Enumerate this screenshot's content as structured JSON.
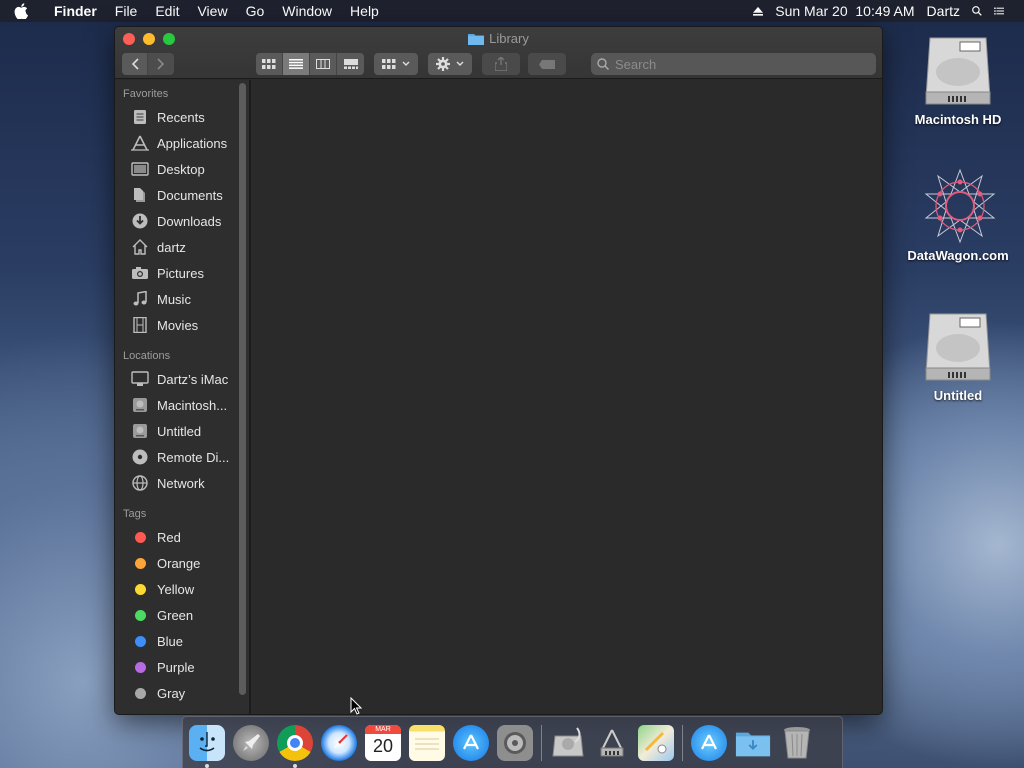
{
  "menubar": {
    "app_name": "Finder",
    "menus": [
      "File",
      "Edit",
      "View",
      "Go",
      "Window",
      "Help"
    ],
    "clock": "Sun Mar 20  10:49 AM",
    "user": "Dartz"
  },
  "window": {
    "title": "Library",
    "search_placeholder": "Search"
  },
  "sidebar": {
    "favorites_label": "Favorites",
    "favorites": [
      {
        "label": "Recents",
        "icon": "recents-icon"
      },
      {
        "label": "Applications",
        "icon": "applications-icon"
      },
      {
        "label": "Desktop",
        "icon": "desktop-icon"
      },
      {
        "label": "Documents",
        "icon": "documents-icon"
      },
      {
        "label": "Downloads",
        "icon": "downloads-icon"
      },
      {
        "label": "dartz",
        "icon": "home-icon"
      },
      {
        "label": "Pictures",
        "icon": "pictures-icon"
      },
      {
        "label": "Music",
        "icon": "music-icon"
      },
      {
        "label": "Movies",
        "icon": "movies-icon"
      }
    ],
    "locations_label": "Locations",
    "locations": [
      {
        "label": "Dartz’s iMac",
        "icon": "imac-icon"
      },
      {
        "label": "Macintosh...",
        "icon": "disk-icon"
      },
      {
        "label": "Untitled",
        "icon": "disk-icon"
      },
      {
        "label": "Remote Di...",
        "icon": "optical-disc-icon"
      },
      {
        "label": "Network",
        "icon": "network-icon"
      }
    ],
    "tags_label": "Tags",
    "tags": [
      {
        "label": "Red",
        "color": "#fc5a52"
      },
      {
        "label": "Orange",
        "color": "#fba53a"
      },
      {
        "label": "Yellow",
        "color": "#fbd932"
      },
      {
        "label": "Green",
        "color": "#4cd964"
      },
      {
        "label": "Blue",
        "color": "#3e8ef7"
      },
      {
        "label": "Purple",
        "color": "#b66be3"
      },
      {
        "label": "Gray",
        "color": "#a8a8a8"
      }
    ]
  },
  "desktop": {
    "icons": [
      {
        "label": "Macintosh HD"
      },
      {
        "label": "DataWagon.com"
      },
      {
        "label": "Untitled"
      }
    ]
  },
  "dock": {
    "apps": [
      "Finder",
      "Launchpad",
      "Google Chrome",
      "Safari",
      "Calendar",
      "Notes",
      "App Store",
      "System Preferences",
      "Disk Utility",
      "Directory Utility",
      "Maps",
      "App Store Folder",
      "Downloads Folder",
      "Trash"
    ],
    "calendar_month": "MAR",
    "calendar_day": "20"
  }
}
